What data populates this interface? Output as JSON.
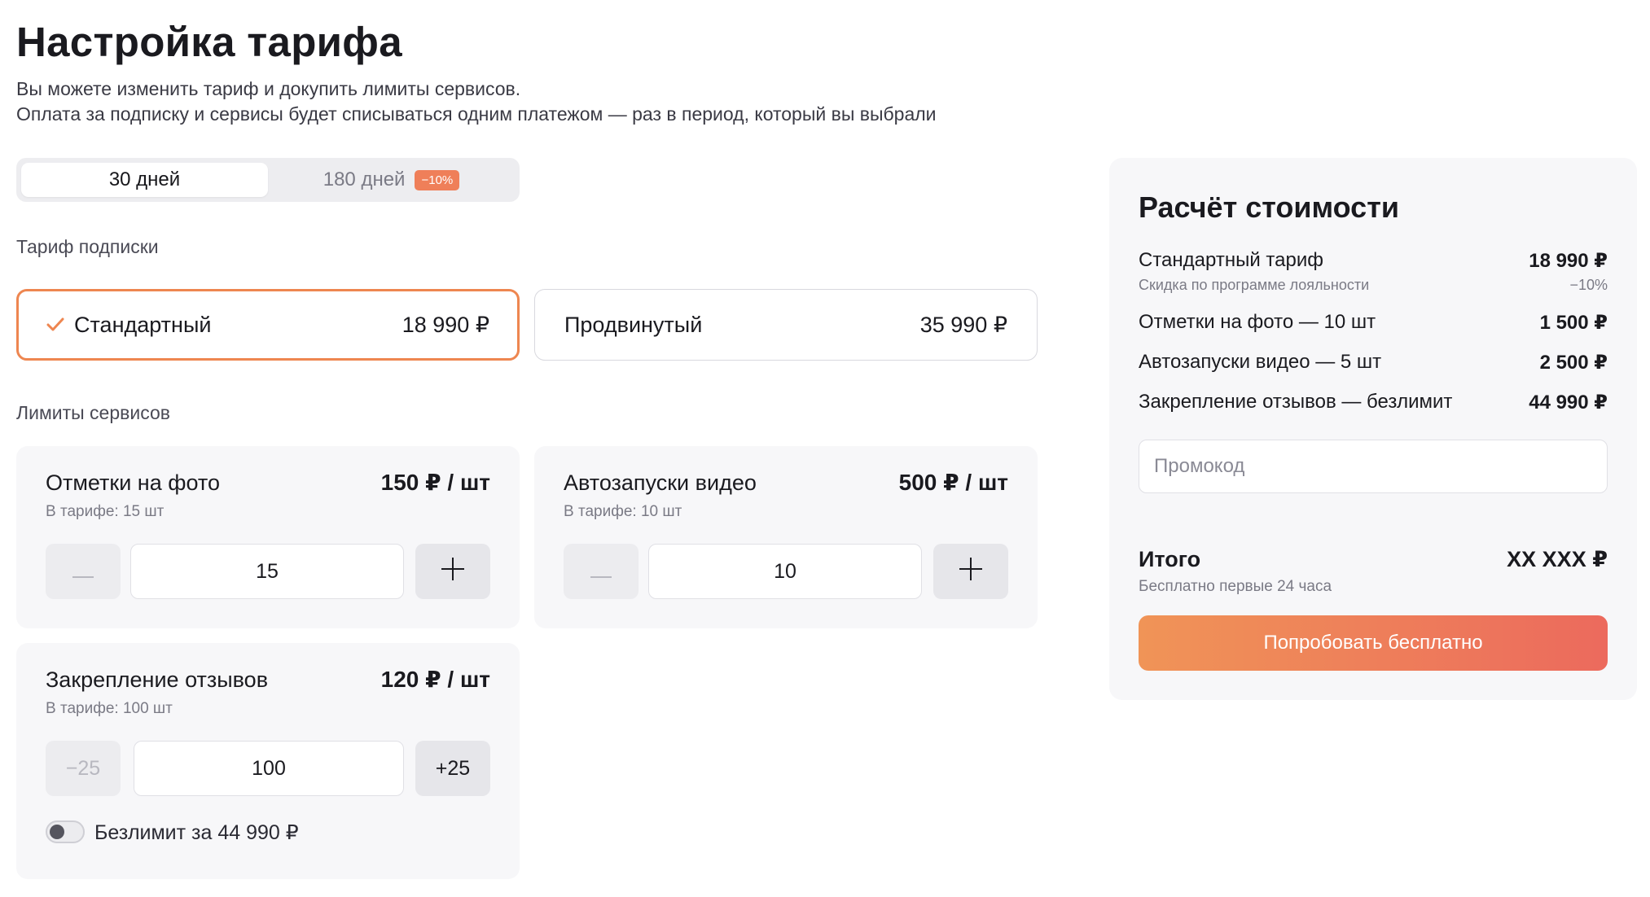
{
  "header": {
    "title": "Настройка тарифа",
    "subtitle_line1": "Вы можете изменить тариф и докупить лимиты сервисов.",
    "subtitle_line2": "Оплата за подписку и сервисы будет списываться одним платежом — раз в период, который вы выбрали"
  },
  "period": {
    "tab_30": "30 дней",
    "tab_180": "180 дней",
    "discount_badge": "−10%",
    "selected": "30 дней"
  },
  "plans": {
    "section_label": "Тариф подписки",
    "standard": {
      "name": "Стандартный",
      "price": "18 990 ₽",
      "selected": true
    },
    "advanced": {
      "name": "Продвинутый",
      "price": "35 990 ₽",
      "selected": false
    }
  },
  "services": {
    "section_label": "Лимиты сервисов",
    "photo_marks": {
      "name": "Отметки на фото",
      "price": "150 ₽ / шт",
      "included": "В тарифе: 15 шт",
      "value": "15"
    },
    "video_autostarts": {
      "name": "Автозапуски видео",
      "price": "500 ₽ / шт",
      "included": "В тарифе: 10 шт",
      "value": "10"
    },
    "review_pins": {
      "name": "Закрепление отзывов",
      "price": "120 ₽ / шт",
      "included": "В тарифе: 100 шт",
      "value": "100",
      "minus_label": "−25",
      "plus_label": "+25",
      "unlimited_label": "Безлимит за 44 990 ₽",
      "unlimited_on": false
    }
  },
  "summary": {
    "title": "Расчёт стоимости",
    "rows": [
      {
        "label": "Стандартный тариф",
        "value": "18 990 ₽"
      },
      {
        "label": "Отметки на фото — 10 шт",
        "value": "1 500 ₽"
      },
      {
        "label": "Автозапуски видео — 5 шт",
        "value": "2 500 ₽"
      },
      {
        "label": "Закрепление отзывов — безлимит",
        "value": "44 990 ₽"
      }
    ],
    "loyalty_label": "Скидка по программе лояльности",
    "loyalty_value": "−10%",
    "promo_placeholder": "Промокод",
    "total_label": "Итого",
    "total_value": "XX XXX ₽",
    "total_note": "Бесплатно первые 24 часа",
    "cta_label": "Попробовать бесплатно"
  },
  "colors": {
    "accent": "#ee8650",
    "badge": "#ef7f59",
    "cta_gradient_start": "#f09457",
    "cta_gradient_end": "#ec6a5d"
  },
  "icons": {
    "check": "check-icon",
    "minus": "minus-icon",
    "plus": "plus-icon"
  }
}
